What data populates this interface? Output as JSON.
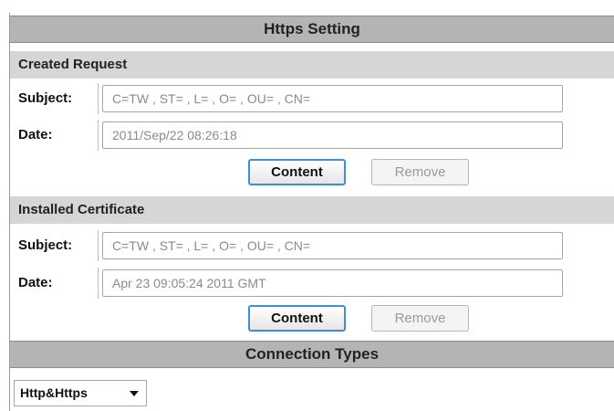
{
  "page": {
    "title": "Https Setting"
  },
  "created_request": {
    "heading": "Created Request",
    "subject_label": "Subject:",
    "subject_value": "C=TW , ST= , L= , O= , OU= , CN=",
    "date_label": "Date:",
    "date_value": "2011/Sep/22 08:26:18",
    "content_button": "Content",
    "remove_button": "Remove"
  },
  "installed_certificate": {
    "heading": "Installed Certificate",
    "subject_label": "Subject:",
    "subject_value": "C=TW , ST= , L= , O= , OU= , CN=",
    "date_label": "Date:",
    "date_value": "Apr 23 09:05:24 2011 GMT",
    "content_button": "Content",
    "remove_button": "Remove"
  },
  "connection_types": {
    "heading": "Connection Types",
    "selected": "Http&Https"
  }
}
